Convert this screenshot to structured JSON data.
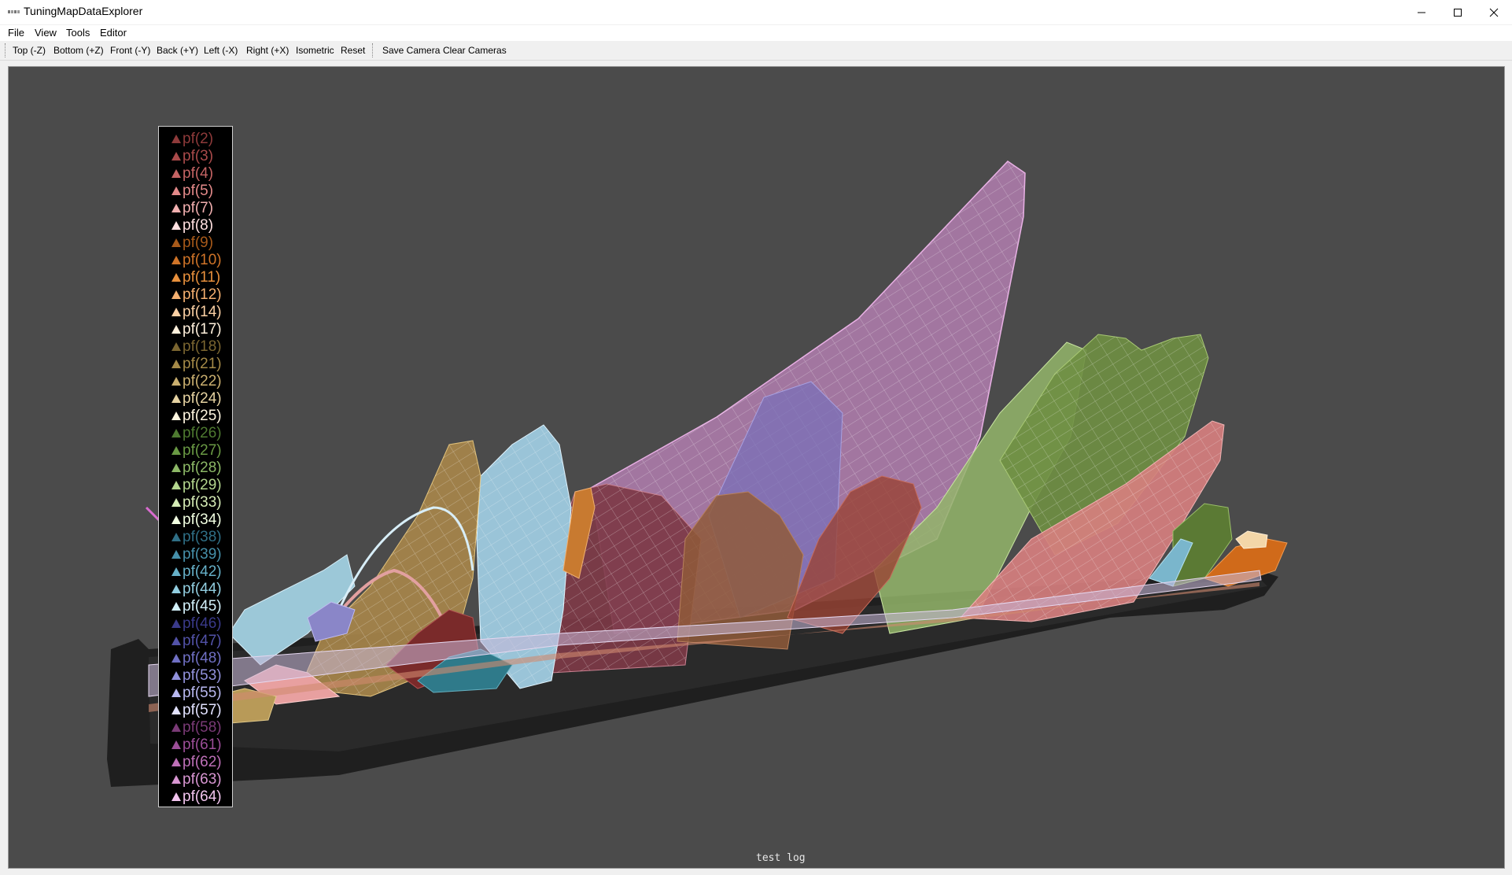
{
  "window": {
    "title": "TuningMapDataExplorer"
  },
  "menu": [
    "File",
    "View",
    "Tools",
    "Editor"
  ],
  "toolbar": {
    "views": [
      "Top (-Z)",
      "Bottom (+Z)",
      "Front (-Y)",
      "Back (+Y)",
      "Left (-X)",
      "Right (+X)",
      "Isometric",
      "Reset"
    ],
    "camera": [
      "Save Camera",
      "Clear Cameras"
    ]
  },
  "legend": [
    {
      "label": "pf(2)",
      "color": "#8e3a3a"
    },
    {
      "label": "pf(3)",
      "color": "#a94a4a"
    },
    {
      "label": "pf(4)",
      "color": "#c56464"
    },
    {
      "label": "pf(5)",
      "color": "#e48a8a"
    },
    {
      "label": "pf(7)",
      "color": "#f2b0b0"
    },
    {
      "label": "pf(8)",
      "color": "#ffe0e0"
    },
    {
      "label": "pf(9)",
      "color": "#a85a1a"
    },
    {
      "label": "pf(10)",
      "color": "#d07428"
    },
    {
      "label": "pf(11)",
      "color": "#e8903c"
    },
    {
      "label": "pf(12)",
      "color": "#f5b070"
    },
    {
      "label": "pf(14)",
      "color": "#fbd0a4"
    },
    {
      "label": "pf(17)",
      "color": "#fff0dc"
    },
    {
      "label": "pf(18)",
      "color": "#7a6530"
    },
    {
      "label": "pf(21)",
      "color": "#a58a48"
    },
    {
      "label": "pf(22)",
      "color": "#cbb070"
    },
    {
      "label": "pf(24)",
      "color": "#e6d3a2"
    },
    {
      "label": "pf(25)",
      "color": "#fff6e0"
    },
    {
      "label": "pf(26)",
      "color": "#4e7a30"
    },
    {
      "label": "pf(27)",
      "color": "#6a9a44"
    },
    {
      "label": "pf(28)",
      "color": "#8cb866"
    },
    {
      "label": "pf(29)",
      "color": "#b4d68e"
    },
    {
      "label": "pf(33)",
      "color": "#d6ecb6"
    },
    {
      "label": "pf(34)",
      "color": "#f2ffe2"
    },
    {
      "label": "pf(38)",
      "color": "#2f6f86"
    },
    {
      "label": "pf(39)",
      "color": "#4690aa"
    },
    {
      "label": "pf(42)",
      "color": "#66b0c8"
    },
    {
      "label": "pf(44)",
      "color": "#92cee0"
    },
    {
      "label": "pf(45)",
      "color": "#d2f0fa"
    },
    {
      "label": "pf(46)",
      "color": "#3a3a8a"
    },
    {
      "label": "pf(47)",
      "color": "#5252a8"
    },
    {
      "label": "pf(48)",
      "color": "#7070c4"
    },
    {
      "label": "pf(53)",
      "color": "#9292dc"
    },
    {
      "label": "pf(55)",
      "color": "#b8b8f0"
    },
    {
      "label": "pf(57)",
      "color": "#e2e2ff"
    },
    {
      "label": "pf(58)",
      "color": "#7a3a76"
    },
    {
      "label": "pf(61)",
      "color": "#9c4e98"
    },
    {
      "label": "pf(62)",
      "color": "#be70b8"
    },
    {
      "label": "pf(63)",
      "color": "#d896d2"
    },
    {
      "label": "pf(64)",
      "color": "#f2c4ee"
    }
  ],
  "status": {
    "log": "test log"
  }
}
